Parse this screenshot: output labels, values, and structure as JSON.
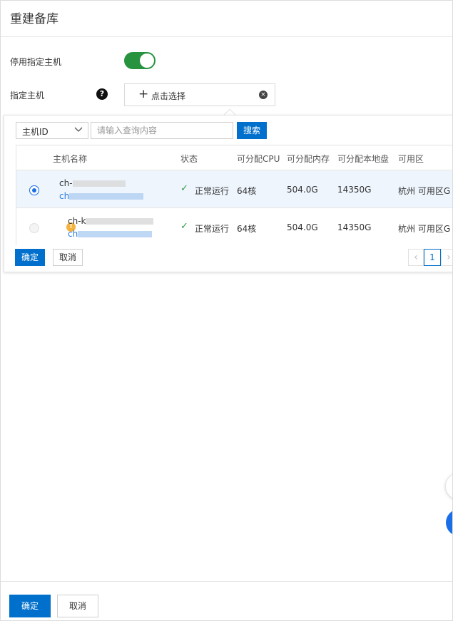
{
  "dialog": {
    "title": "重建备库"
  },
  "form": {
    "disable_label": "停用指定主机",
    "toggle_on": true,
    "host_label": "指定主机",
    "help_icon": "question-icon",
    "picker_text": "点击选择",
    "picker_plus": "+"
  },
  "popup": {
    "filter_select": "主机ID",
    "search_placeholder": "请输入查询内容",
    "search_button": "搜索",
    "columns": [
      "主机名称",
      "状态",
      "可分配CPU",
      "可分配内存",
      "可分配本地盘",
      "可用区"
    ],
    "rows": [
      {
        "selected": true,
        "name_prefix": "ch-",
        "id_prefix": "ch",
        "warning": false,
        "status": "正常运行",
        "cpu": "64核",
        "memory": "504.0G",
        "disk": "14350G",
        "zone": "杭州 可用区G"
      },
      {
        "selected": false,
        "name_prefix": "ch-k",
        "id_prefix": "ch",
        "warning": true,
        "status": "正常运行",
        "cpu": "64核",
        "memory": "504.0G",
        "disk": "14350G",
        "zone": "杭州 可用区G"
      }
    ],
    "confirm_label": "确定",
    "cancel_label": "取消",
    "pager": {
      "current": "1",
      "prev": "‹",
      "next": "›"
    }
  },
  "footer": {
    "confirm_label": "确定",
    "cancel_label": "取消"
  },
  "colors": {
    "primary": "#0070cc",
    "toggle": "#27933f",
    "success": "#2e9a43",
    "warning": "#f3b33d"
  }
}
